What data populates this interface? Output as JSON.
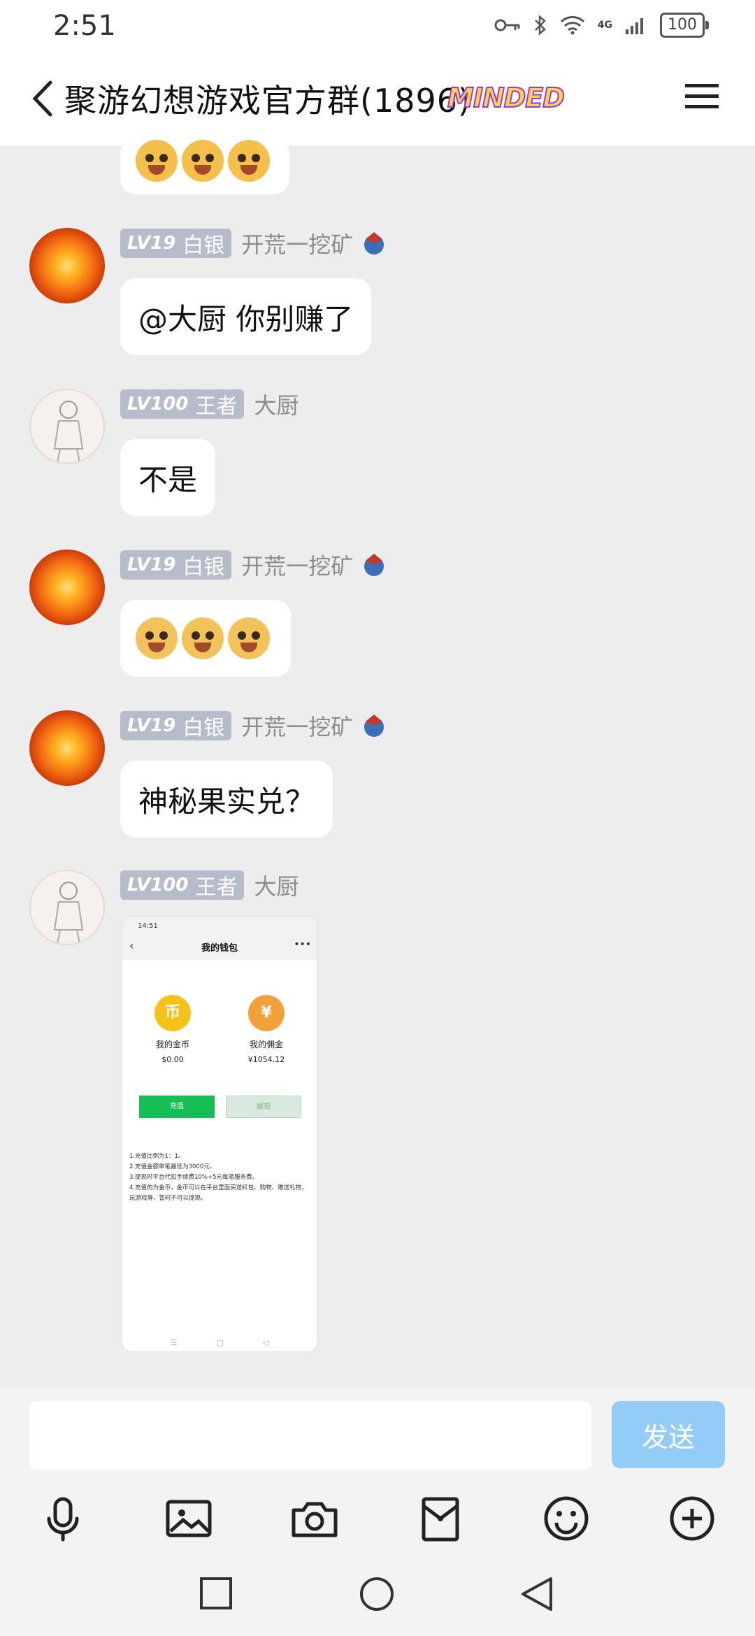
{
  "status_bar": {
    "time": "2:51",
    "battery": "100",
    "network": "4G"
  },
  "header": {
    "title": "聚游幻想游戏官方群(1896)",
    "badge": "MINDED"
  },
  "messages": [
    {
      "type": "emoji",
      "emojis": [
        "cry",
        "cry",
        "cry"
      ]
    },
    {
      "level": "LV19",
      "rank": "白银",
      "nickname": "开荒一挖矿",
      "text": "@大厨 你别赚了"
    },
    {
      "level": "LV100",
      "rank": "王者",
      "nickname": "大厨",
      "text": "不是"
    },
    {
      "level": "LV19",
      "rank": "白银",
      "nickname": "开荒一挖矿",
      "emojis": [
        "dog",
        "dog",
        "dog"
      ]
    },
    {
      "level": "LV19",
      "rank": "白银",
      "nickname": "开荒一挖矿",
      "text": "神秘果实兑？"
    },
    {
      "level": "LV100",
      "rank": "王者",
      "nickname": "大厨",
      "type": "image"
    }
  ],
  "screenshot": {
    "time": "14:51",
    "title": "我的钱包",
    "coins_label": "我的金币",
    "coins_value": "$0.00",
    "commission_label": "我的佣金",
    "commission_value": "¥1054.12",
    "coin_glyph": "币",
    "commission_glyph": "¥",
    "recharge_button": "充值",
    "withdraw_button": "提现",
    "notes": [
      "1.充值比例为1：1。",
      "2.充值金额单笔最低为3000元。",
      "3.提现时平台代扣手续费10%+5元每笔服务费。",
      "4.充值的为金币，金币可以在平台里面买送红包、购物、赠送礼物，玩游戏等，暂时不可以提现。"
    ]
  },
  "input": {
    "placeholder": "",
    "send_label": "发送"
  },
  "toolbar": [
    "mic-icon",
    "image-icon",
    "camera-icon",
    "red-packet-icon",
    "smile-icon",
    "plus-icon"
  ]
}
